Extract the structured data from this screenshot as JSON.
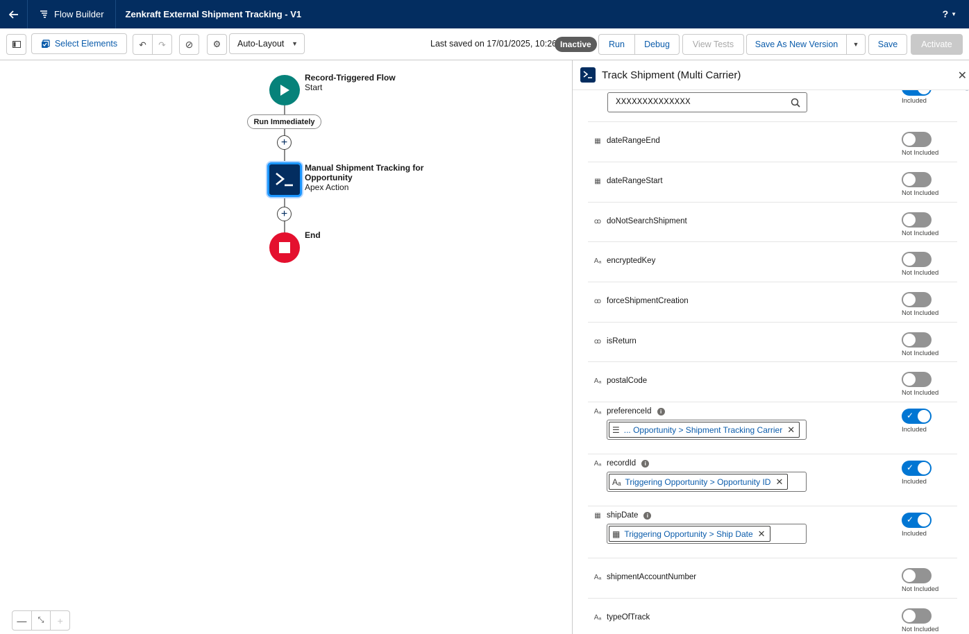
{
  "header": {
    "back_icon": "arrow-left-icon",
    "app_name": "Flow Builder",
    "flow_title": "Zenkraft External Shipment Tracking - V1",
    "help_label": "?"
  },
  "toolbar": {
    "select_elements": "Select Elements",
    "layout_mode": "Auto-Layout",
    "last_saved": "Last saved on 17/01/2025, 10:26",
    "status": "Inactive",
    "run": "Run",
    "debug": "Debug",
    "view_tests": "View Tests",
    "save_as_new": "Save As New Version",
    "save": "Save",
    "activate": "Activate"
  },
  "canvas": {
    "start_title": "Record-Triggered Flow",
    "start_sub": "Start",
    "path_label": "Run Immediately",
    "action_title_1": "Manual Shipment Tracking for",
    "action_title_2": "Opportunity",
    "action_sub": "Apex Action",
    "end_title": "End"
  },
  "panel": {
    "title": "Track Shipment (Multi Carrier)",
    "top_value": "XXXXXXXXXXXXXX",
    "top_toggle_label": "Included",
    "params": [
      {
        "name": "dateRangeEnd",
        "type_icon": "calendar-icon",
        "status": "Not Included"
      },
      {
        "name": "dateRangeStart",
        "type_icon": "calendar-icon",
        "status": "Not Included"
      },
      {
        "name": "doNotSearchShipment",
        "type_icon": "boolean-icon",
        "status": "Not Included"
      },
      {
        "name": "encryptedKey",
        "type_icon": "text-icon",
        "status": "Not Included"
      },
      {
        "name": "forceShipmentCreation",
        "type_icon": "boolean-icon",
        "status": "Not Included"
      },
      {
        "name": "isReturn",
        "type_icon": "boolean-icon",
        "status": "Not Included"
      },
      {
        "name": "postalCode",
        "type_icon": "text-icon",
        "status": "Not Included"
      },
      {
        "name": "preferenceId",
        "type_icon": "text-icon",
        "status": "Included",
        "value": "... Opportunity > Shipment Tracking Carrier"
      },
      {
        "name": "recordId",
        "type_icon": "text-icon",
        "status": "Included",
        "value": "Triggering Opportunity > Opportunity ID"
      },
      {
        "name": "shipDate",
        "type_icon": "calendar-icon",
        "status": "Included",
        "value": "Triggering Opportunity > Ship Date"
      },
      {
        "name": "shipmentAccountNumber",
        "type_icon": "text-icon",
        "status": "Not Included"
      },
      {
        "name": "typeOfTrack",
        "type_icon": "text-icon",
        "status": "Not Included"
      }
    ]
  },
  "colors": {
    "header_bg": "#032d60",
    "accent": "#0176d3",
    "start_node": "#06827a",
    "end_node": "#e4102e"
  }
}
